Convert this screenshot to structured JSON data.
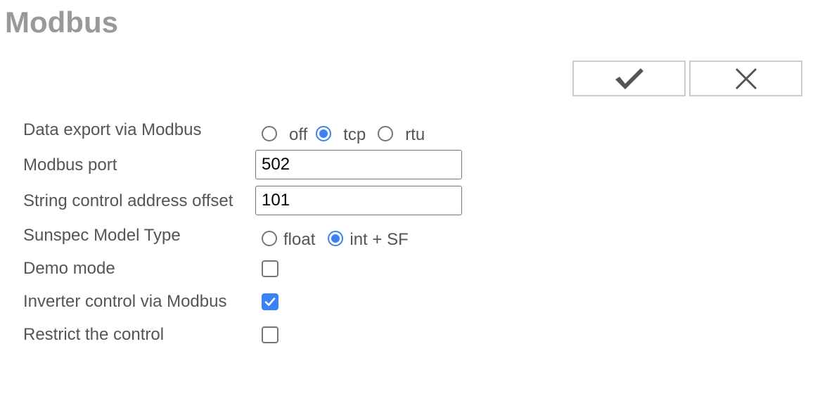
{
  "page": {
    "title": "Modbus"
  },
  "actions": {
    "confirm_icon": "checkmark-icon",
    "cancel_icon": "close-icon"
  },
  "form": {
    "data_export": {
      "label": "Data export via Modbus",
      "options": [
        {
          "label": "off",
          "checked": false
        },
        {
          "label": "tcp",
          "checked": true
        },
        {
          "label": "rtu",
          "checked": false
        }
      ]
    },
    "modbus_port": {
      "label": "Modbus port",
      "value": "502"
    },
    "string_offset": {
      "label": "String control address offset",
      "value": "101"
    },
    "sunspec_type": {
      "label": "Sunspec Model Type",
      "options": [
        {
          "label": "float",
          "checked": false
        },
        {
          "label": "int + SF",
          "checked": true
        }
      ]
    },
    "demo_mode": {
      "label": "Demo mode",
      "checked": false
    },
    "inverter_control": {
      "label": "Inverter control via Modbus",
      "checked": true
    },
    "restrict_control": {
      "label": "Restrict the control",
      "checked": false
    }
  },
  "colors": {
    "accent": "#3b82f6",
    "title": "#999999",
    "label": "#555555",
    "button_border": "#cccccc"
  }
}
